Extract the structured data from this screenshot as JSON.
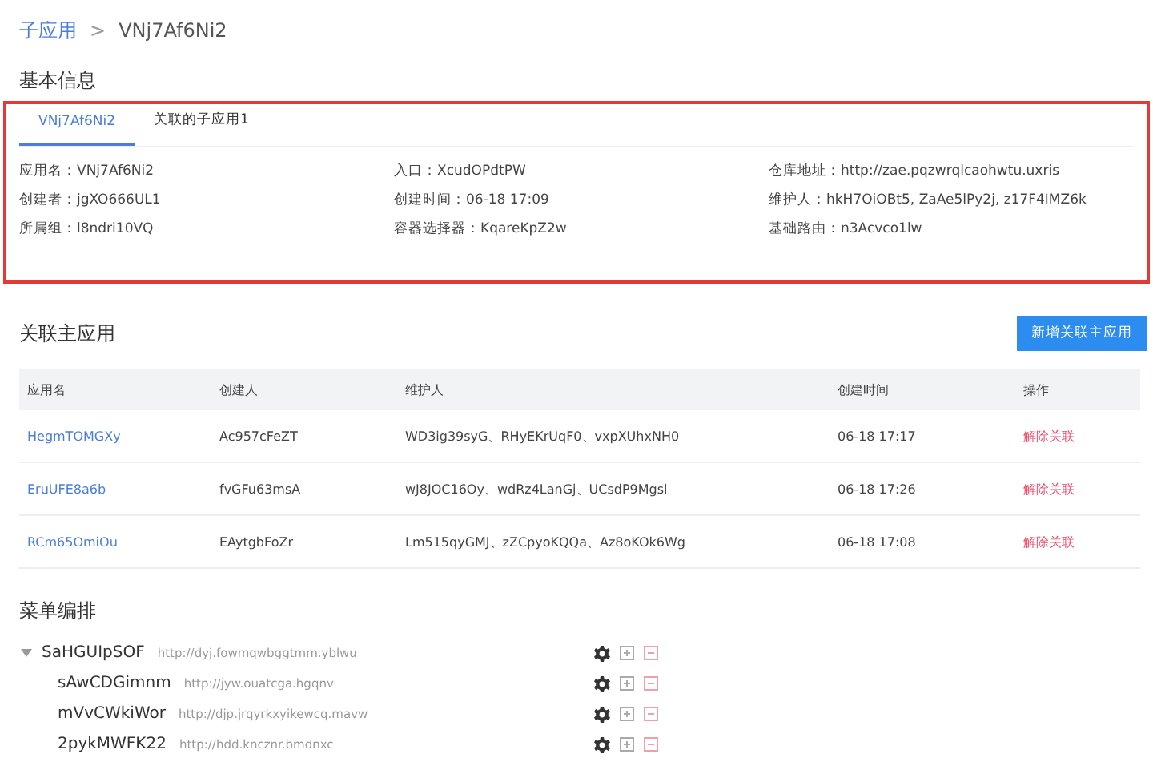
{
  "breadcrumb": {
    "parent": "子应用",
    "separator": ">",
    "current": "VNj7Af6Ni2"
  },
  "basic_info": {
    "title": "基本信息",
    "tabs": [
      {
        "label": "VNj7Af6Ni2",
        "selected": true
      },
      {
        "label": "关联的子应用1",
        "selected": false
      }
    ],
    "fields": [
      {
        "label": "应用名：",
        "value": "VNj7Af6Ni2"
      },
      {
        "label": "入口：",
        "value": "XcudOPdtPW"
      },
      {
        "label": "仓库地址：",
        "value": "http://zae.pqzwrqlcaohwtu.uxris"
      },
      {
        "label": "创建者：",
        "value": "jgXO666UL1"
      },
      {
        "label": "创建时间：",
        "value": "06-18 17:09"
      },
      {
        "label": "维护人：",
        "value": "hkH7OiOBt5, ZaAe5lPy2j, z17F4IMZ6k"
      },
      {
        "label": "所属组：",
        "value": "l8ndri10VQ"
      },
      {
        "label": "容器选择器：",
        "value": "KqareKpZ2w"
      },
      {
        "label": "基础路由：",
        "value": "n3Acvco1lw"
      }
    ]
  },
  "main_apps": {
    "title": "关联主应用",
    "add_button": "新增关联主应用",
    "table": {
      "columns": [
        "应用名",
        "创建人",
        "维护人",
        "创建时间",
        "操作"
      ],
      "rows": [
        {
          "name": "HegmTOMGXy",
          "creator": "Ac957cFeZT",
          "maintainers": "WD3ig39syG、RHyEKrUqF0、vxpXUhxNH0",
          "created": "06-18 17:17",
          "action": "解除关联"
        },
        {
          "name": "EruUFE8a6b",
          "creator": "fvGFu63msA",
          "maintainers": "wJ8JOC16Oy、wdRz4LanGj、UCsdP9Mgsl",
          "created": "06-18 17:26",
          "action": "解除关联"
        },
        {
          "name": "RCm65OmiOu",
          "creator": "EAytgbFoZr",
          "maintainers": "Lm515qyGMJ、zZCpyoKQQa、Az8oKOk6Wg",
          "created": "06-18 17:08",
          "action": "解除关联"
        }
      ]
    }
  },
  "menu": {
    "title": "菜单编排",
    "tree": [
      {
        "name": "SaHGUIpSOF",
        "url": "http://dyj.fowmqwbggtmm.yblwu",
        "expanded": true,
        "children": [
          {
            "name": "sAwCDGimnm",
            "url": "http://jyw.ouatcga.hgqnv"
          },
          {
            "name": "mVvCWkiWor",
            "url": "http://djp.jrqyrkxyikewcq.mavw"
          },
          {
            "name": "2pykMWFK22",
            "url": "http://hdd.kncznr.bmdnxc"
          }
        ]
      }
    ]
  }
}
